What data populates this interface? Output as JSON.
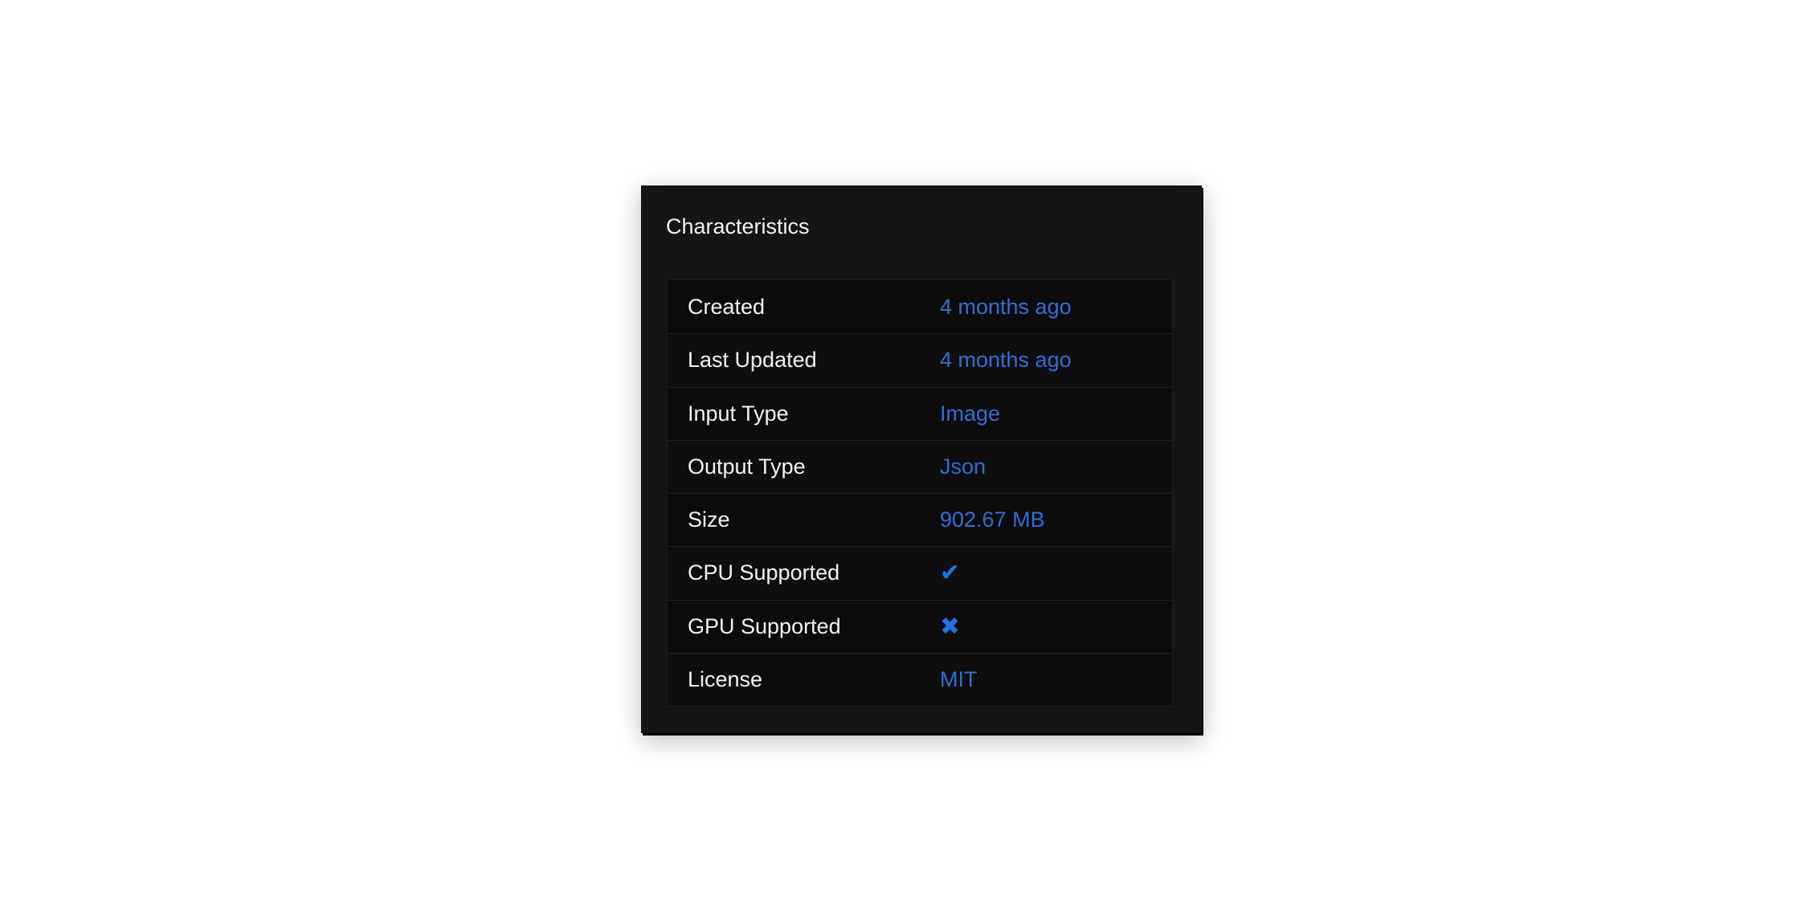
{
  "panel": {
    "title": "Characteristics"
  },
  "rows": [
    {
      "label": "Created",
      "value": "4 months ago"
    },
    {
      "label": "Last Updated",
      "value": "4 months ago"
    },
    {
      "label": "Input Type",
      "value": "Image"
    },
    {
      "label": "Output Type",
      "value": "Json"
    },
    {
      "label": "Size",
      "value": "902.67 MB"
    },
    {
      "label": "CPU Supported",
      "value": "✔",
      "icon": "check-icon"
    },
    {
      "label": "GPU Supported",
      "value": "✖",
      "icon": "cross-icon"
    },
    {
      "label": "License",
      "value": "MIT"
    }
  ],
  "colors": {
    "panel_background": "#151517",
    "label_text": "#f2f2f2",
    "value_text": "#2f6fd6",
    "icon_accent": "#1f74e6"
  }
}
